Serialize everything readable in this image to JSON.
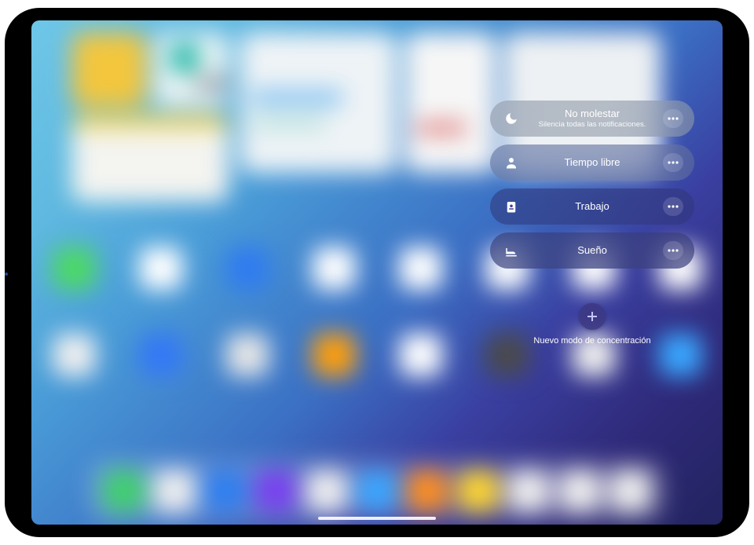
{
  "focus_panel": {
    "items": [
      {
        "icon": "moon-icon",
        "title": "No molestar",
        "subtitle": "Silencia todas las notificaciones."
      },
      {
        "icon": "person-icon",
        "title": "Tiempo libre",
        "subtitle": ""
      },
      {
        "icon": "badge-icon",
        "title": "Trabajo",
        "subtitle": ""
      },
      {
        "icon": "bed-icon",
        "title": "Sueño",
        "subtitle": ""
      }
    ],
    "new_focus_label": "Nuevo modo de concentración"
  },
  "background": {
    "icon_colors_row1": [
      "#4cd964",
      "#fff",
      "#2f7bf0",
      "#fff",
      "#fff",
      "#fff",
      "#fff",
      "#fff"
    ],
    "icon_colors_row2": [
      "#efefef",
      "#3478f6",
      "#e6e6e6",
      "#ff9f0a",
      "#fff",
      "#4a4a4a",
      "#efefef",
      "#3aa7ff"
    ],
    "dock_icon_colors": [
      "#3fd06b",
      "#efefef",
      "#2d7ef0",
      "#7a3ff0",
      "#efefef",
      "#3aa7ff",
      "#ff8f1f",
      "#ffd630",
      "#efefef",
      "#efefef",
      "#efefef"
    ]
  }
}
